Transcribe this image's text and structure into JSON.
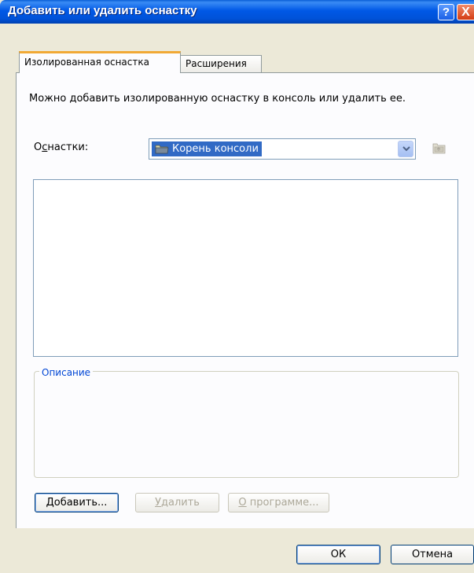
{
  "window": {
    "title": "Добавить или удалить оснастку",
    "help_button": "?",
    "close_button": "X"
  },
  "tabs": [
    {
      "label": "Изолированная оснастка",
      "active": true
    },
    {
      "label": "Расширения",
      "active": false
    }
  ],
  "standalone": {
    "description": "Можно добавить изолированную оснастку в консоль или удалить ее.",
    "snapins_label_prefix": "О",
    "snapins_label_hotkey": "с",
    "snapins_label_suffix": "настки:",
    "combo_value": "Корень консоли",
    "list_items": [],
    "description_group_label": "Описание"
  },
  "buttons": {
    "add_hotkey": "Д",
    "add_rest": "обавить...",
    "remove_hotkey": "У",
    "remove_rest": "далить",
    "about_hotkey": "О",
    "about_rest": " программе...",
    "ok": "ОК",
    "cancel": "Отмена"
  },
  "colors": {
    "title_bar": "#0058e6",
    "selection": "#316ac5",
    "tab_highlight": "#f1a935",
    "group_label": "#0046d5"
  },
  "icons": {
    "combo_icon": "folder-icon",
    "up_folder": "up-folder-icon",
    "dropdown": "chevron-down-icon"
  }
}
